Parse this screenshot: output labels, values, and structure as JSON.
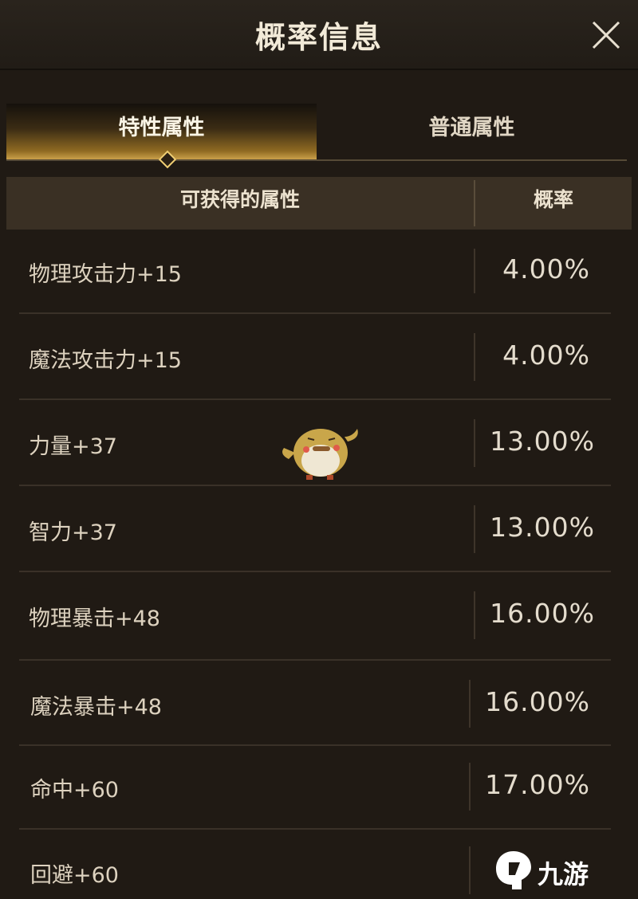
{
  "header": {
    "title": "概率信息"
  },
  "tabs": [
    {
      "label": "特性属性",
      "active": true
    },
    {
      "label": "普通属性",
      "active": false
    }
  ],
  "table": {
    "columns": [
      "可获得的属性",
      "概率"
    ],
    "rows": [
      {
        "attribute": "物理攻击力+15",
        "rate": "4.00%"
      },
      {
        "attribute": "魔法攻击力+15",
        "rate": "4.00%"
      },
      {
        "attribute": "力量+37",
        "rate": "13.00%"
      },
      {
        "attribute": "智力+37",
        "rate": "13.00%"
      },
      {
        "attribute": "物理暴击+48",
        "rate": "16.00%"
      },
      {
        "attribute": "魔法暴击+48",
        "rate": "16.00%"
      },
      {
        "attribute": "命中+60",
        "rate": "17.00%"
      },
      {
        "attribute": "回避+60",
        "rate": ""
      }
    ]
  },
  "watermark": {
    "text": "九游"
  },
  "colors": {
    "accent_gold": "#caa04a",
    "background": "#201a14"
  }
}
